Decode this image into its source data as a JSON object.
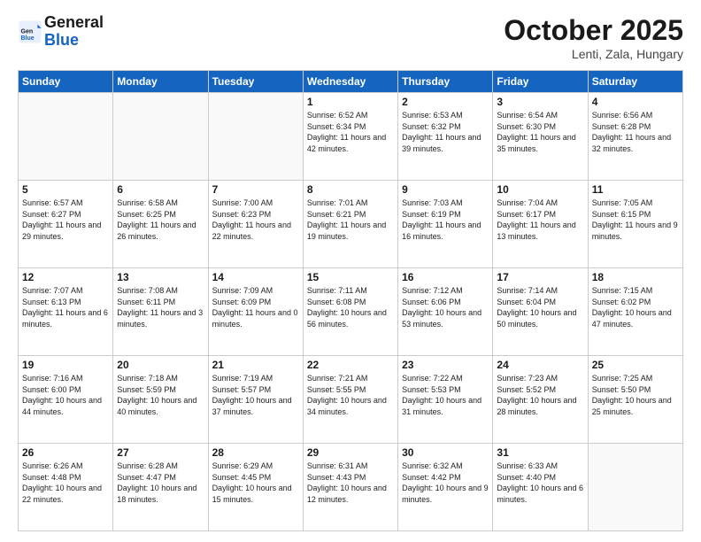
{
  "header": {
    "logo_general": "General",
    "logo_blue": "Blue",
    "month_title": "October 2025",
    "subtitle": "Lenti, Zala, Hungary"
  },
  "weekdays": [
    "Sunday",
    "Monday",
    "Tuesday",
    "Wednesday",
    "Thursday",
    "Friday",
    "Saturday"
  ],
  "weeks": [
    [
      {
        "day": "",
        "info": ""
      },
      {
        "day": "",
        "info": ""
      },
      {
        "day": "",
        "info": ""
      },
      {
        "day": "1",
        "info": "Sunrise: 6:52 AM\nSunset: 6:34 PM\nDaylight: 11 hours\nand 42 minutes."
      },
      {
        "day": "2",
        "info": "Sunrise: 6:53 AM\nSunset: 6:32 PM\nDaylight: 11 hours\nand 39 minutes."
      },
      {
        "day": "3",
        "info": "Sunrise: 6:54 AM\nSunset: 6:30 PM\nDaylight: 11 hours\nand 35 minutes."
      },
      {
        "day": "4",
        "info": "Sunrise: 6:56 AM\nSunset: 6:28 PM\nDaylight: 11 hours\nand 32 minutes."
      }
    ],
    [
      {
        "day": "5",
        "info": "Sunrise: 6:57 AM\nSunset: 6:27 PM\nDaylight: 11 hours\nand 29 minutes."
      },
      {
        "day": "6",
        "info": "Sunrise: 6:58 AM\nSunset: 6:25 PM\nDaylight: 11 hours\nand 26 minutes."
      },
      {
        "day": "7",
        "info": "Sunrise: 7:00 AM\nSunset: 6:23 PM\nDaylight: 11 hours\nand 22 minutes."
      },
      {
        "day": "8",
        "info": "Sunrise: 7:01 AM\nSunset: 6:21 PM\nDaylight: 11 hours\nand 19 minutes."
      },
      {
        "day": "9",
        "info": "Sunrise: 7:03 AM\nSunset: 6:19 PM\nDaylight: 11 hours\nand 16 minutes."
      },
      {
        "day": "10",
        "info": "Sunrise: 7:04 AM\nSunset: 6:17 PM\nDaylight: 11 hours\nand 13 minutes."
      },
      {
        "day": "11",
        "info": "Sunrise: 7:05 AM\nSunset: 6:15 PM\nDaylight: 11 hours\nand 9 minutes."
      }
    ],
    [
      {
        "day": "12",
        "info": "Sunrise: 7:07 AM\nSunset: 6:13 PM\nDaylight: 11 hours\nand 6 minutes."
      },
      {
        "day": "13",
        "info": "Sunrise: 7:08 AM\nSunset: 6:11 PM\nDaylight: 11 hours\nand 3 minutes."
      },
      {
        "day": "14",
        "info": "Sunrise: 7:09 AM\nSunset: 6:09 PM\nDaylight: 11 hours\nand 0 minutes."
      },
      {
        "day": "15",
        "info": "Sunrise: 7:11 AM\nSunset: 6:08 PM\nDaylight: 10 hours\nand 56 minutes."
      },
      {
        "day": "16",
        "info": "Sunrise: 7:12 AM\nSunset: 6:06 PM\nDaylight: 10 hours\nand 53 minutes."
      },
      {
        "day": "17",
        "info": "Sunrise: 7:14 AM\nSunset: 6:04 PM\nDaylight: 10 hours\nand 50 minutes."
      },
      {
        "day": "18",
        "info": "Sunrise: 7:15 AM\nSunset: 6:02 PM\nDaylight: 10 hours\nand 47 minutes."
      }
    ],
    [
      {
        "day": "19",
        "info": "Sunrise: 7:16 AM\nSunset: 6:00 PM\nDaylight: 10 hours\nand 44 minutes."
      },
      {
        "day": "20",
        "info": "Sunrise: 7:18 AM\nSunset: 5:59 PM\nDaylight: 10 hours\nand 40 minutes."
      },
      {
        "day": "21",
        "info": "Sunrise: 7:19 AM\nSunset: 5:57 PM\nDaylight: 10 hours\nand 37 minutes."
      },
      {
        "day": "22",
        "info": "Sunrise: 7:21 AM\nSunset: 5:55 PM\nDaylight: 10 hours\nand 34 minutes."
      },
      {
        "day": "23",
        "info": "Sunrise: 7:22 AM\nSunset: 5:53 PM\nDaylight: 10 hours\nand 31 minutes."
      },
      {
        "day": "24",
        "info": "Sunrise: 7:23 AM\nSunset: 5:52 PM\nDaylight: 10 hours\nand 28 minutes."
      },
      {
        "day": "25",
        "info": "Sunrise: 7:25 AM\nSunset: 5:50 PM\nDaylight: 10 hours\nand 25 minutes."
      }
    ],
    [
      {
        "day": "26",
        "info": "Sunrise: 6:26 AM\nSunset: 4:48 PM\nDaylight: 10 hours\nand 22 minutes."
      },
      {
        "day": "27",
        "info": "Sunrise: 6:28 AM\nSunset: 4:47 PM\nDaylight: 10 hours\nand 18 minutes."
      },
      {
        "day": "28",
        "info": "Sunrise: 6:29 AM\nSunset: 4:45 PM\nDaylight: 10 hours\nand 15 minutes."
      },
      {
        "day": "29",
        "info": "Sunrise: 6:31 AM\nSunset: 4:43 PM\nDaylight: 10 hours\nand 12 minutes."
      },
      {
        "day": "30",
        "info": "Sunrise: 6:32 AM\nSunset: 4:42 PM\nDaylight: 10 hours\nand 9 minutes."
      },
      {
        "day": "31",
        "info": "Sunrise: 6:33 AM\nSunset: 4:40 PM\nDaylight: 10 hours\nand 6 minutes."
      },
      {
        "day": "",
        "info": ""
      }
    ]
  ]
}
